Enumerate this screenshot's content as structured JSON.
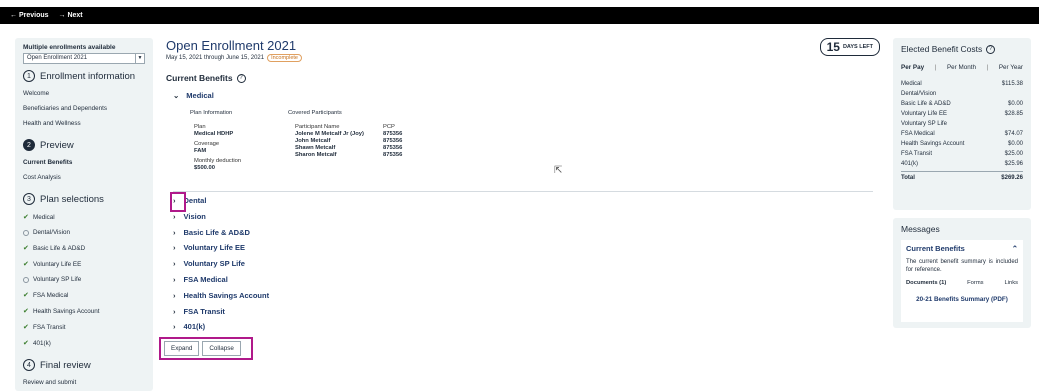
{
  "topbar": {
    "previous": "← Previous",
    "next": "→ Next"
  },
  "left": {
    "multi_label": "Multiple enrollments available",
    "select_value": "Open Enrollment 2021",
    "sections": [
      {
        "num": "1",
        "title": "Enrollment information",
        "items": [
          "Welcome",
          "Beneficiaries and Dependents",
          "Health and Wellness"
        ]
      },
      {
        "num": "2",
        "title": "Preview",
        "items": [
          "Current Benefits",
          "Cost Analysis"
        ]
      },
      {
        "num": "3",
        "title": "Plan selections"
      },
      {
        "num": "4",
        "title": "Final review",
        "items": [
          "Review and submit"
        ]
      }
    ],
    "plan_items": [
      {
        "label": "Medical",
        "status": "check"
      },
      {
        "label": "Dental/Vision",
        "status": "empty"
      },
      {
        "label": "Basic Life & AD&D",
        "status": "check"
      },
      {
        "label": "Voluntary Life EE",
        "status": "check"
      },
      {
        "label": "Voluntary SP Life",
        "status": "empty"
      },
      {
        "label": "FSA Medical",
        "status": "check"
      },
      {
        "label": "Health Savings Account",
        "status": "check"
      },
      {
        "label": "FSA Transit",
        "status": "check"
      },
      {
        "label": "401(k)",
        "status": "check"
      }
    ]
  },
  "main": {
    "title": "Open Enrollment 2021",
    "dates": "May 15, 2021 through June 15, 2021",
    "badge": "Incomplete",
    "days_num": "15",
    "days_text": "DAYS LEFT",
    "current_benefits": "Current Benefits",
    "medical": "Medical",
    "plan_info_label": "Plan Information",
    "covered_label": "Covered Participants",
    "plan_label": "Plan",
    "plan_value": "Medical HDHP",
    "coverage_label": "Coverage",
    "coverage_value": "FAM",
    "deduction_label": "Monthly deduction",
    "deduction_value": "$500.00",
    "participant_col": "Participant Name",
    "pcp_col": "PCP",
    "participants": [
      {
        "name": "Jolene M Metcalf Jr (Joy)",
        "pcp": "875356"
      },
      {
        "name": "John Metcalf",
        "pcp": "875356"
      },
      {
        "name": "Shawn Metcalf",
        "pcp": "875356"
      },
      {
        "name": "Sharon Metcalf",
        "pcp": "875356"
      }
    ],
    "accordion": [
      "Dental",
      "Vision",
      "Basic Life & AD&D",
      "Voluntary Life EE",
      "Voluntary SP Life",
      "FSA Medical",
      "Health Savings Account",
      "FSA Transit",
      "401(k)"
    ],
    "expand": "Expand",
    "collapse": "Collapse"
  },
  "costs": {
    "title": "Elected Benefit Costs",
    "tabs": [
      "Per Pay",
      "Per Month",
      "Per Year"
    ],
    "rows": [
      {
        "label": "Medical",
        "value": "$115.38"
      },
      {
        "label": "Dental/Vision",
        "value": ""
      },
      {
        "label": "Basic Life & AD&D",
        "value": "$0.00"
      },
      {
        "label": "Voluntary Life EE",
        "value": "$28.85"
      },
      {
        "label": "Voluntary SP Life",
        "value": ""
      },
      {
        "label": "FSA Medical",
        "value": "$74.07"
      },
      {
        "label": "Health Savings Account",
        "value": "$0.00"
      },
      {
        "label": "FSA Transit",
        "value": "$25.00"
      },
      {
        "label": "401(k)",
        "value": "$25.96"
      }
    ],
    "total_label": "Total",
    "total_value": "$269.26"
  },
  "messages": {
    "title": "Messages",
    "card_title": "Current Benefits",
    "body": "The current benefit summary is included for reference.",
    "tabs": [
      "Documents (1)",
      "Forms",
      "Links"
    ],
    "link": "20-21 Benefits Summary (PDF)"
  },
  "colors": {
    "accent": "#1f3a6b",
    "highlight": "#b0198a",
    "panel": "#eef3f4"
  }
}
